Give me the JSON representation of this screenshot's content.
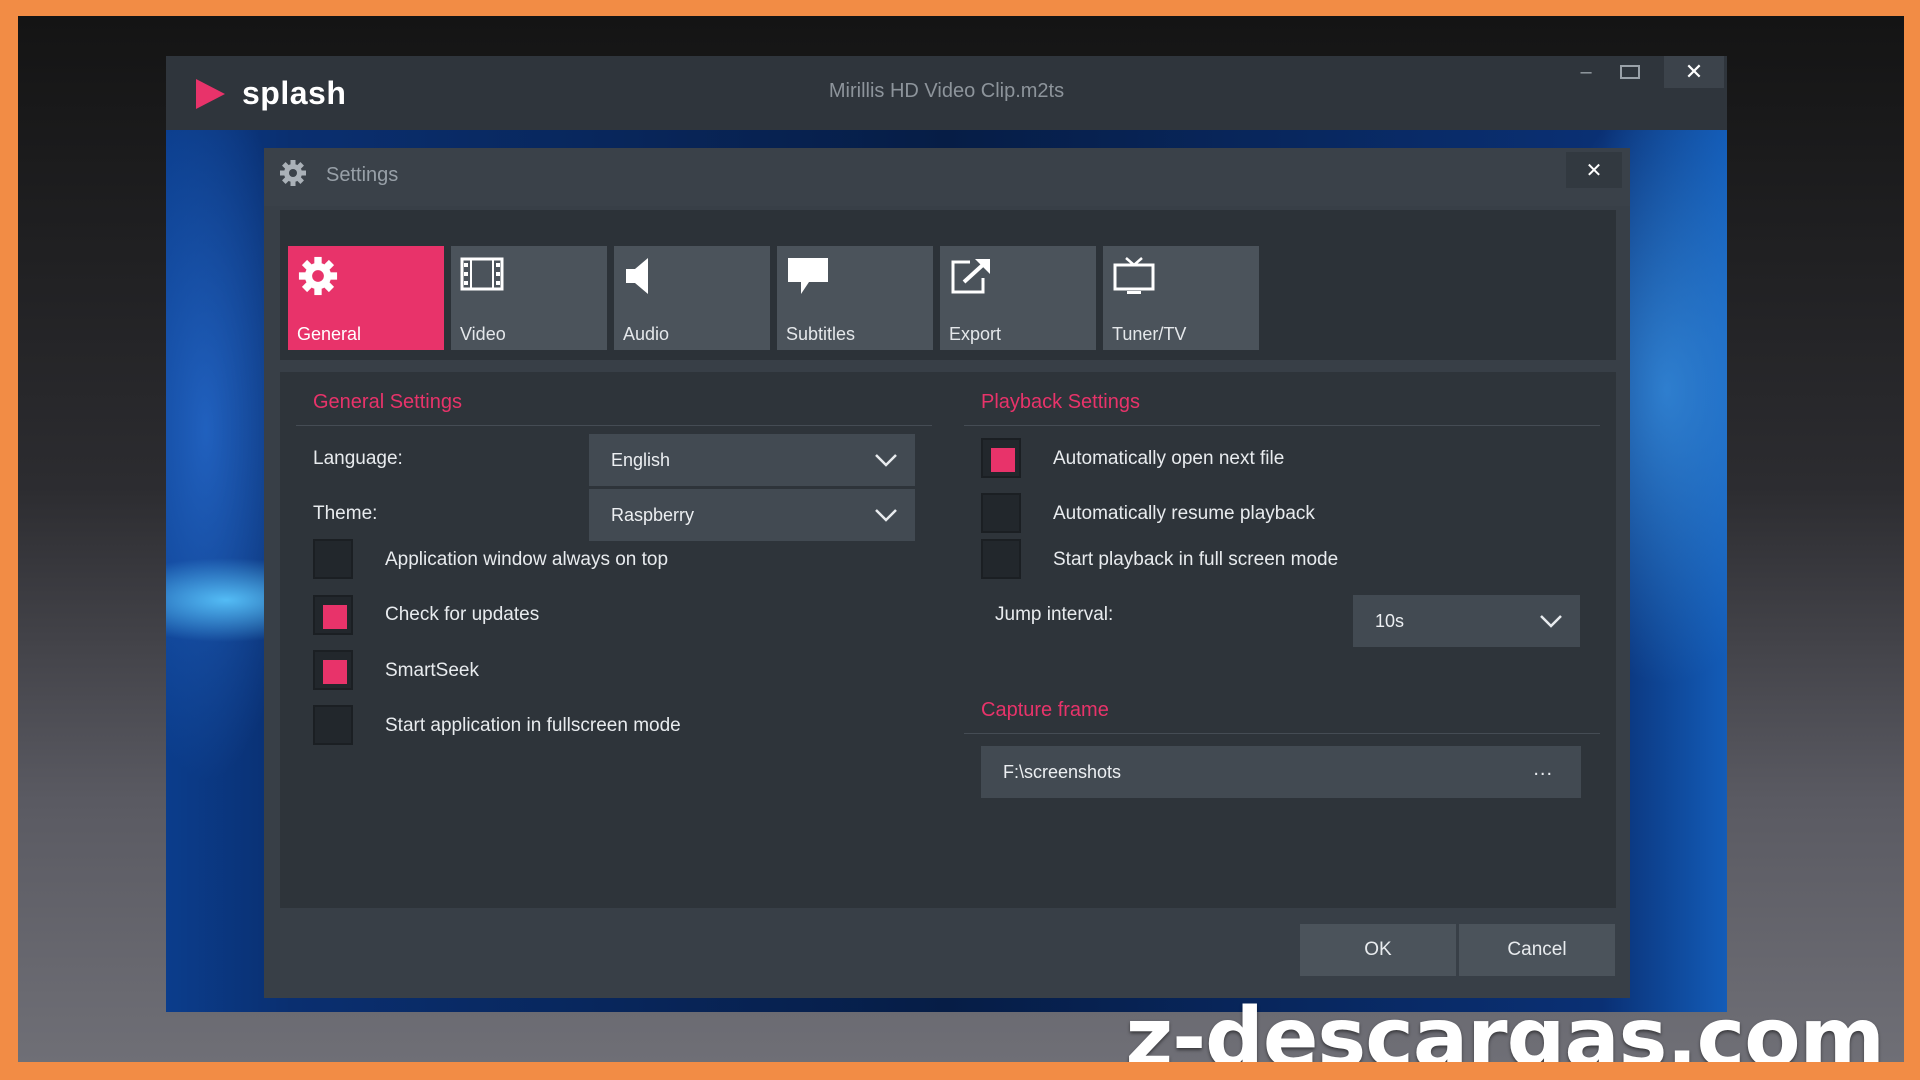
{
  "window": {
    "app_name": "splash",
    "title": "Mirillis HD Video Clip.m2ts",
    "minimize_label": "–",
    "close_label": "✕"
  },
  "dialog": {
    "title": "Settings",
    "close_label": "✕"
  },
  "tabs": [
    {
      "label": "General",
      "icon": "gear-icon",
      "active": true
    },
    {
      "label": "Video",
      "icon": "film-icon",
      "active": false
    },
    {
      "label": "Audio",
      "icon": "speaker-icon",
      "active": false
    },
    {
      "label": "Subtitles",
      "icon": "speech-bubble-icon",
      "active": false
    },
    {
      "label": "Export",
      "icon": "export-icon",
      "active": false
    },
    {
      "label": "Tuner/TV",
      "icon": "tv-icon",
      "active": false
    }
  ],
  "general": {
    "title": "General Settings",
    "language_label": "Language:",
    "language_value": "English",
    "theme_label": "Theme:",
    "theme_value": "Raspberry",
    "options": [
      {
        "label": "Application window always on top",
        "checked": false
      },
      {
        "label": "Check for updates",
        "checked": true
      },
      {
        "label": "SmartSeek",
        "checked": true
      },
      {
        "label": "Start application in fullscreen mode",
        "checked": false
      }
    ]
  },
  "playback": {
    "title": "Playback Settings",
    "options": [
      {
        "label": "Automatically open next file",
        "checked": true
      },
      {
        "label": "Automatically resume playback",
        "checked": false
      },
      {
        "label": "Start playback in full screen mode",
        "checked": false
      }
    ],
    "jump_label": "Jump interval:",
    "jump_value": "10s"
  },
  "capture": {
    "title": "Capture frame",
    "path": "F:\\screenshots",
    "browse_label": "..."
  },
  "buttons": {
    "ok": "OK",
    "cancel": "Cancel"
  },
  "watermark": "z-descargas.com",
  "colors": {
    "accent": "#e8336a",
    "border": "#f28c45"
  }
}
